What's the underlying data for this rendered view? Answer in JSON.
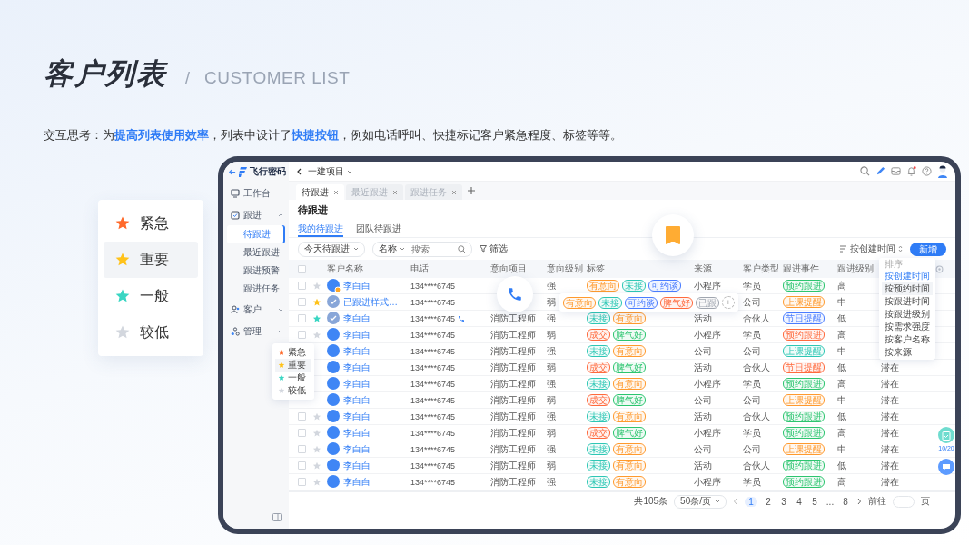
{
  "slide": {
    "title": "客户列表",
    "divider": "/",
    "subtitle": "CUSTOMER LIST",
    "description": "交互思考：为**提高列表使用效率**，列表中设计了**快捷按钮**，例如电话呼叫、快捷标记客户紧急程度、标签等等。"
  },
  "priority_card": {
    "items": [
      {
        "label": "紧急",
        "color": "#ff6a2b",
        "selected": false
      },
      {
        "label": "重要",
        "color": "#ffc21a",
        "selected": true
      },
      {
        "label": "一般",
        "color": "#3ad6c3",
        "selected": false
      },
      {
        "label": "较低",
        "color": "#d3d7de",
        "selected": false
      }
    ]
  },
  "app": {
    "sidebar": {
      "logo": "飞行密码",
      "items": [
        {
          "label": "工作台"
        },
        {
          "label": "跟进",
          "expanded": true,
          "children": [
            {
              "label": "待跟进",
              "selected": true
            },
            {
              "label": "最近跟进",
              "selected": false
            },
            {
              "label": "跟进预警",
              "selected": false
            },
            {
              "label": "跟进任务",
              "selected": false
            }
          ]
        },
        {
          "label": "客户",
          "expanded": false
        },
        {
          "label": "管理",
          "expanded": false
        }
      ]
    },
    "topbar": {
      "project": "一建项目",
      "notification": true
    },
    "tabs": [
      {
        "label": "待跟进",
        "selected": true
      },
      {
        "label": "最近跟进",
        "selected": false
      },
      {
        "label": "跟进任务",
        "selected": false
      }
    ],
    "page_title": "待跟进",
    "subtabs": [
      {
        "label": "我的待跟进",
        "selected": true
      },
      {
        "label": "团队待跟进",
        "selected": false
      }
    ],
    "filters": {
      "range": "今天待跟进",
      "field": "名称",
      "search_placeholder": "搜索",
      "filter": "筛选",
      "sort": "按创建时间",
      "add": "新增"
    },
    "table": {
      "select_all": false,
      "columns": [
        "客户名称",
        "电话",
        "意向项目",
        "意向级别",
        "标签",
        "来源",
        "客户类型",
        "跟进事件",
        "跟进级别"
      ],
      "rows": [
        {
          "checked": false,
          "color": "#d3d7de",
          "followed": false,
          "badge": true,
          "name": "李白白",
          "phone": "134****6745",
          "level": "强",
          "tags": [
            {
              "text": "有意向",
              "color": "#ff9a2e"
            },
            {
              "text": "未接",
              "color": "#2ec7b5"
            },
            {
              "text": "可约谈",
              "color": "#4a7dff"
            }
          ],
          "source": "小程序",
          "type": "学员",
          "event": {
            "text": "预约跟进",
            "color": "#2cc56f"
          },
          "follow_level": "高"
        },
        {
          "checked": false,
          "color": "#ffc21a",
          "followed": true,
          "name": "已跟进样式…",
          "phone": "134****6745",
          "level": "弱",
          "type": "公司",
          "event": {
            "text": "上课提醒",
            "color": "#ff9a2e"
          },
          "follow_level": "中"
        },
        {
          "checked": false,
          "color": "#3ad6c3",
          "followed": true,
          "call": true,
          "name": "李白白",
          "phone": "134****6745",
          "project": "消防工程师",
          "level": "强",
          "tags": [
            {
              "text": "未接",
              "color": "#2ec7b5"
            },
            {
              "text": "有意向",
              "color": "#ff9a2e"
            }
          ],
          "source": "活动",
          "type": "合伙人",
          "event": {
            "text": "节日提醒",
            "color": "#4a7dff"
          },
          "follow_level": "低"
        },
        {
          "checked": false,
          "color": "#d3d7de",
          "followed": false,
          "name": "李白白",
          "phone": "134****6745",
          "project": "消防工程师",
          "level": "弱",
          "tags": [
            {
              "text": "成交",
              "color": "#ff6a3d"
            },
            {
              "text": "脾气好",
              "color": "#2cc56f"
            }
          ],
          "source": "小程序",
          "type": "学员",
          "event": {
            "text": "预约跟进",
            "color": "#ff6a3d"
          },
          "follow_level": "高"
        },
        {
          "followed": false,
          "name": "李白白",
          "phone": "134****6745",
          "project": "消防工程师",
          "level": "强",
          "tags": [
            {
              "text": "未接",
              "color": "#2ec7b5"
            },
            {
              "text": "有意向",
              "color": "#ff9a2e"
            }
          ],
          "source": "公司",
          "type": "公司",
          "event": {
            "text": "上课提醒",
            "color": "#2ec7b5"
          },
          "follow_level": "中"
        },
        {
          "followed": false,
          "name": "李白白",
          "phone": "134****6745",
          "project": "消防工程师",
          "level": "弱",
          "tags": [
            {
              "text": "成交",
              "color": "#ff6a3d"
            },
            {
              "text": "脾气好",
              "color": "#2cc56f"
            }
          ],
          "source": "活动",
          "type": "合伙人",
          "event": {
            "text": "节日提醒",
            "color": "#ff6a3d"
          },
          "follow_level": "低",
          "status": "潜在"
        },
        {
          "followed": false,
          "name": "李白白",
          "phone": "134****6745",
          "project": "消防工程师",
          "level": "强",
          "tags": [
            {
              "text": "未接",
              "color": "#2ec7b5"
            },
            {
              "text": "有意向",
              "color": "#ff9a2e"
            }
          ],
          "source": "小程序",
          "type": "学员",
          "event": {
            "text": "预约跟进",
            "color": "#2cc56f"
          },
          "follow_level": "高",
          "status": "潜在"
        },
        {
          "followed": false,
          "name": "李白白",
          "phone": "134****6745",
          "project": "消防工程师",
          "level": "弱",
          "tags": [
            {
              "text": "成交",
              "color": "#ff6a3d"
            },
            {
              "text": "脾气好",
              "color": "#2cc56f"
            }
          ],
          "source": "公司",
          "type": "公司",
          "event": {
            "text": "上课提醒",
            "color": "#ff9a2e"
          },
          "follow_level": "中",
          "status": "潜在"
        },
        {
          "checked": false,
          "color": "#d3d7de",
          "followed": false,
          "name": "李白白",
          "phone": "134****6745",
          "project": "消防工程师",
          "level": "强",
          "tags": [
            {
              "text": "未接",
              "color": "#2ec7b5"
            },
            {
              "text": "有意向",
              "color": "#ff9a2e"
            }
          ],
          "source": "活动",
          "type": "合伙人",
          "event": {
            "text": "预约跟进",
            "color": "#2cc56f"
          },
          "follow_level": "低",
          "status": "潜在"
        },
        {
          "checked": false,
          "color": "#d3d7de",
          "followed": false,
          "name": "李白白",
          "phone": "134****6745",
          "project": "消防工程师",
          "level": "弱",
          "tags": [
            {
              "text": "成交",
              "color": "#ff6a3d"
            },
            {
              "text": "脾气好",
              "color": "#2cc56f"
            }
          ],
          "source": "小程序",
          "type": "学员",
          "event": {
            "text": "预约跟进",
            "color": "#2cc56f"
          },
          "follow_level": "高",
          "status": "潜在"
        },
        {
          "checked": false,
          "color": "#d3d7de",
          "followed": false,
          "name": "李白白",
          "phone": "134****6745",
          "project": "消防工程师",
          "level": "强",
          "tags": [
            {
              "text": "未接",
              "color": "#2ec7b5"
            },
            {
              "text": "有意向",
              "color": "#ff9a2e"
            }
          ],
          "source": "公司",
          "type": "公司",
          "event": {
            "text": "上课提醒",
            "color": "#ff9a2e"
          },
          "follow_level": "中",
          "status": "潜在"
        },
        {
          "checked": false,
          "color": "#d3d7de",
          "followed": false,
          "name": "李白白",
          "phone": "134****6745",
          "project": "消防工程师",
          "level": "弱",
          "tags": [
            {
              "text": "未接",
              "color": "#2ec7b5"
            },
            {
              "text": "有意向",
              "color": "#ff9a2e"
            }
          ],
          "source": "活动",
          "type": "合伙人",
          "event": {
            "text": "预约跟进",
            "color": "#2cc56f"
          },
          "follow_level": "低",
          "status": "潜在"
        },
        {
          "checked": false,
          "color": "#d3d7de",
          "followed": false,
          "name": "李白白",
          "phone": "134****6745",
          "project": "消防工程师",
          "level": "强",
          "tags": [
            {
              "text": "未接",
              "color": "#2ec7b5"
            },
            {
              "text": "有意向",
              "color": "#ff9a2e"
            }
          ],
          "source": "小程序",
          "type": "学员",
          "event": {
            "text": "预约跟进",
            "color": "#2cc56f"
          },
          "follow_level": "高",
          "status": "潜在"
        }
      ]
    },
    "tag_popup": {
      "tags": [
        {
          "text": "有意向",
          "color": "#ff9a2e"
        },
        {
          "text": "未接",
          "color": "#2ec7b5"
        },
        {
          "text": "可约谈",
          "color": "#4a7dff"
        },
        {
          "text": "脾气好",
          "color": "#ff6a3d"
        },
        {
          "text": "已跟",
          "color": "#a0a6b0"
        }
      ],
      "add": "+"
    },
    "star_menu": {
      "items": [
        {
          "label": "紧急",
          "color": "#ff6a2b",
          "selected": false
        },
        {
          "label": "重要",
          "color": "#ffc21a",
          "selected": true
        },
        {
          "label": "一般",
          "color": "#3ad6c3",
          "selected": false
        },
        {
          "label": "较低",
          "color": "#d3d7de",
          "selected": false
        }
      ]
    },
    "sort_menu": {
      "title": "排序",
      "items": [
        {
          "label": "按创建时间",
          "selected": true,
          "hovered": false
        },
        {
          "label": "按预约时间",
          "selected": false,
          "hovered": true
        },
        {
          "label": "按跟进时间",
          "selected": false,
          "hovered": false
        },
        {
          "label": "按跟进级别",
          "selected": false,
          "hovered": false
        },
        {
          "label": "按需求强度",
          "selected": false,
          "hovered": false
        },
        {
          "label": "按客户名称",
          "selected": false,
          "hovered": false
        },
        {
          "label": "按来源",
          "selected": false,
          "hovered": false
        }
      ]
    },
    "task_counter": "10/20",
    "pagination": {
      "total": "共105条",
      "page_size": "50条/页",
      "pages": [
        {
          "label": "1",
          "selected": true
        },
        {
          "label": "2",
          "selected": false
        },
        {
          "label": "3",
          "selected": false
        },
        {
          "label": "4",
          "selected": false
        },
        {
          "label": "5",
          "selected": false
        },
        {
          "label": "...",
          "selected": false
        },
        {
          "label": "8",
          "selected": false
        }
      ],
      "goto": "前往",
      "unit": "页"
    }
  }
}
